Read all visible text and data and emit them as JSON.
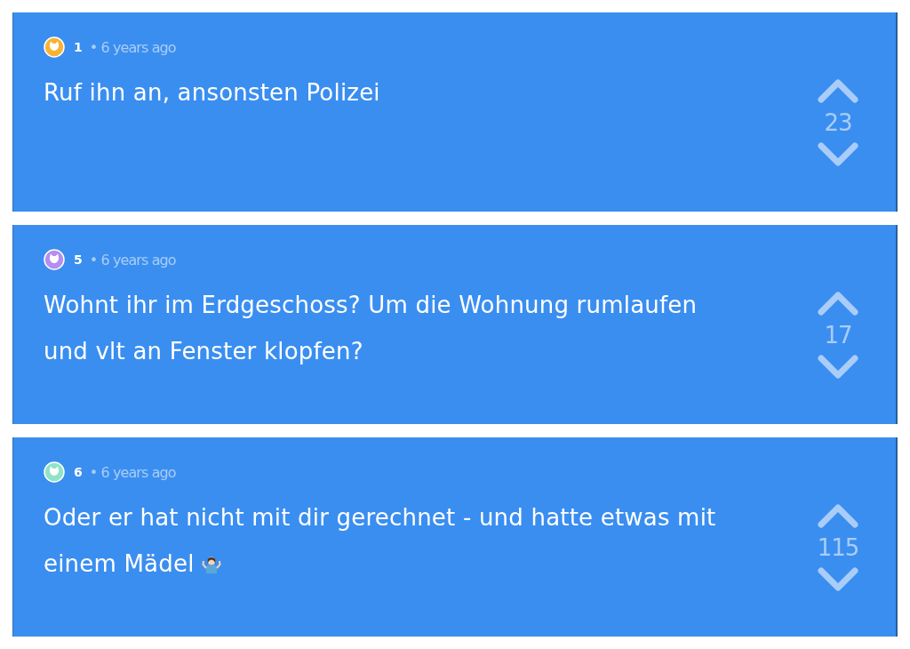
{
  "comments": [
    {
      "author": "1",
      "color": "#f7b433",
      "time": "• 6 years ago",
      "text": "Ruf ihn an, ansonsten Polizei",
      "votes": "23",
      "emoji": false
    },
    {
      "author": "5",
      "color": "#b48ef2",
      "time": "• 6 years ago",
      "text": "Wohnt ihr im Erdgeschoss? Um die Wohnung rumlaufen und vlt an Fenster klopfen?",
      "votes": "17",
      "emoji": false
    },
    {
      "author": "6",
      "color": "#8fe3c6",
      "time": "• 6 years ago",
      "text": "Oder er hat nicht mit dir gerechnet - und hatte etwas mit einem Mädel",
      "votes": "115",
      "emoji": true
    }
  ]
}
